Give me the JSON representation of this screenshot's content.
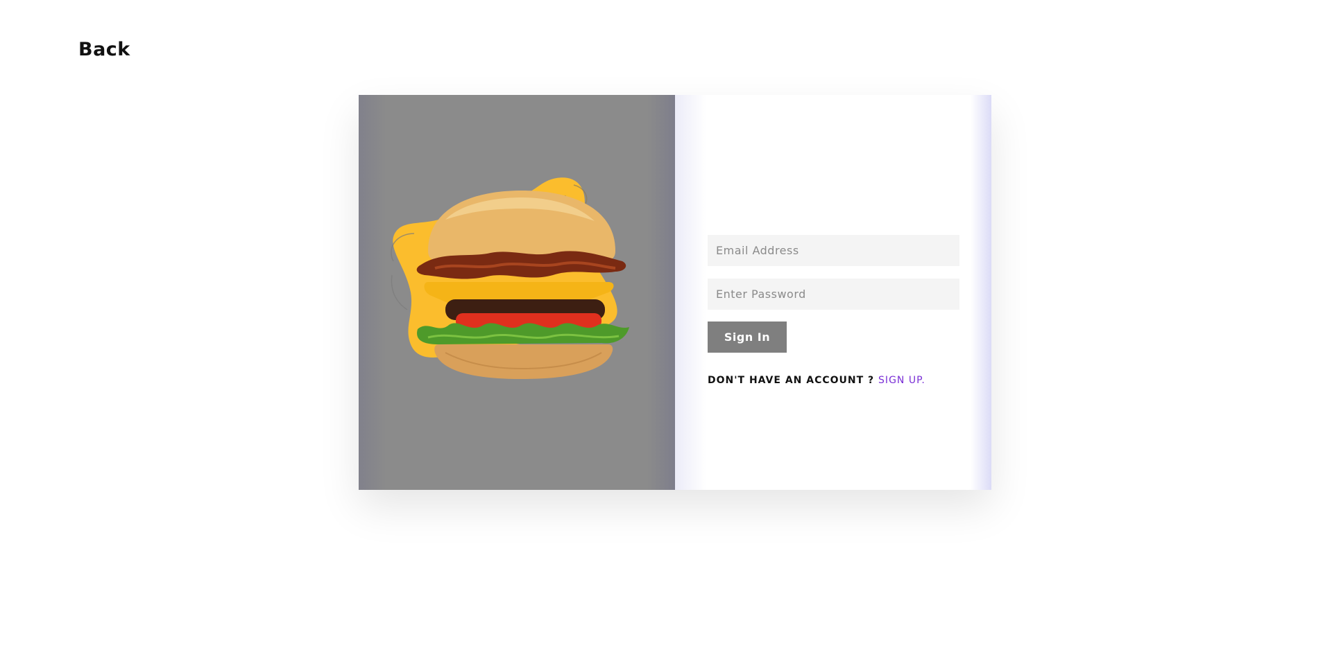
{
  "nav": {
    "back_label": "Back"
  },
  "form": {
    "email_placeholder": "Email Address",
    "password_placeholder": "Enter Password",
    "signin_label": "Sign In",
    "no_account_text": "DON'T HAVE AN ACCOUNT ?",
    "signup_label": "SIGN UP."
  },
  "colors": {
    "image_panel_bg": "#8b8b8b",
    "blob_yellow": "#fbbd2d",
    "button_bg": "#7f7f7f",
    "link_purple": "#7a2fd6",
    "input_bg": "#f4f4f4"
  },
  "images": {
    "hero": "burger-illustration"
  }
}
